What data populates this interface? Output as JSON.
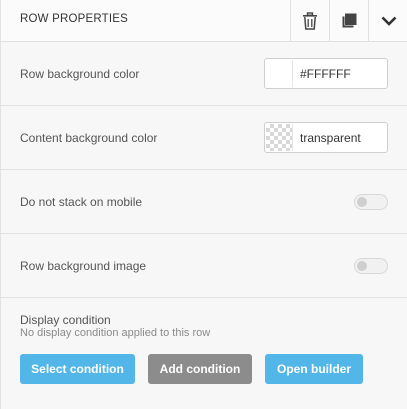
{
  "header": {
    "title": "ROW PROPERTIES",
    "icons": [
      "trash-icon",
      "copy-icon",
      "chevron-down-icon"
    ]
  },
  "rows": {
    "row_bg_color": {
      "label": "Row background color",
      "value": "#FFFFFF"
    },
    "content_bg_color": {
      "label": "Content background color",
      "value": "transparent"
    },
    "no_stack_mobile": {
      "label": "Do not stack on mobile",
      "enabled": false
    },
    "row_bg_image": {
      "label": "Row background image",
      "enabled": false
    }
  },
  "display_condition": {
    "title": "Display condition",
    "subtitle": "No display condition applied to this row",
    "select_label": "Select condition",
    "add_label": "Add condition",
    "open_label": "Open builder"
  },
  "colors": {
    "accent_blue": "#52b6e8",
    "button_gray": "#8c8c8c"
  }
}
